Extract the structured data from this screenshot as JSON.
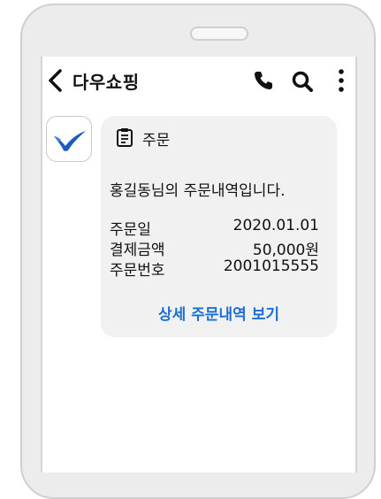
{
  "header": {
    "title": "다우쇼핑",
    "back_icon": "chevron-left-icon",
    "call_icon": "phone-icon",
    "search_icon": "search-icon",
    "more_icon": "more-vertical-icon"
  },
  "message": {
    "avatar_icon": "brand-logo-icon",
    "title_icon": "clipboard-icon",
    "title": "주문",
    "greeting": "홍길동님의 주문내역입니다.",
    "rows": [
      {
        "label": "주문일",
        "value": "2020.01.01"
      },
      {
        "label": "결제금액",
        "value": "50,000원"
      },
      {
        "label": "주문번호",
        "value": "2001015555"
      }
    ],
    "detail_link": "상세 주문내역 보기"
  },
  "colors": {
    "accent": "#1a6fd6",
    "logo_blue": "#1e5bbf",
    "bubble_bg": "#f1f1f1",
    "frame": "#ececec"
  }
}
